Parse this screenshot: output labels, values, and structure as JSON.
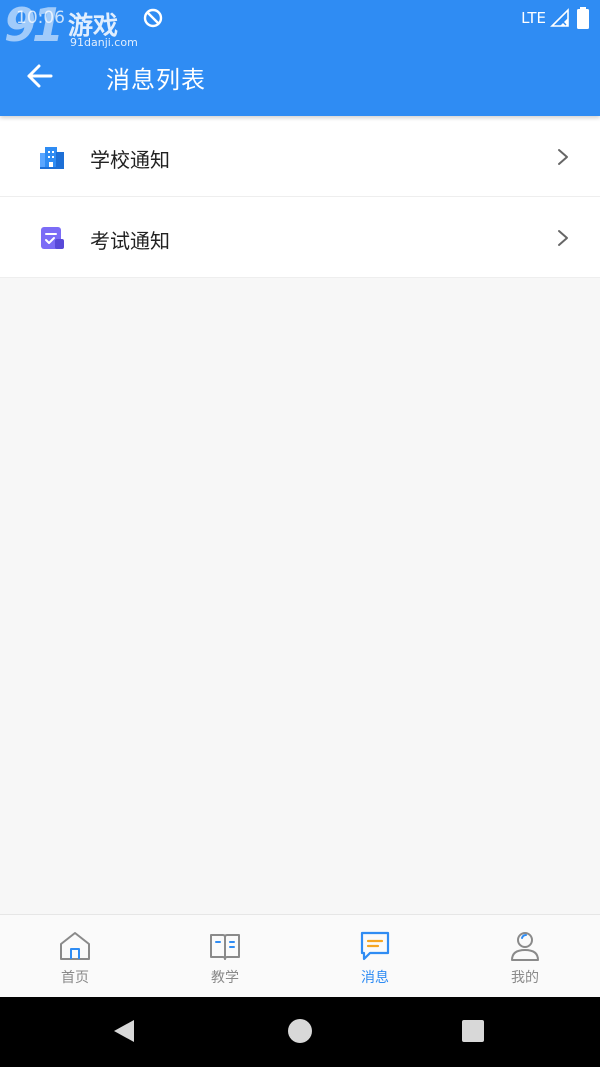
{
  "status_bar": {
    "time": "10:06",
    "network": "LTE",
    "watermark_cn": "游戏",
    "watermark_num": "91",
    "watermark_url": "91danji.com"
  },
  "toolbar": {
    "title": "消息列表"
  },
  "list": {
    "items": [
      {
        "label": "学校通知",
        "icon": "school-building-icon"
      },
      {
        "label": "考试通知",
        "icon": "exam-note-icon"
      }
    ]
  },
  "tabbar": {
    "tabs": [
      {
        "label": "首页",
        "icon": "home-icon",
        "active": false
      },
      {
        "label": "教学",
        "icon": "book-icon",
        "active": false
      },
      {
        "label": "消息",
        "icon": "message-icon",
        "active": true
      },
      {
        "label": "我的",
        "icon": "user-icon",
        "active": false
      }
    ]
  },
  "colors": {
    "primary": "#2f8cf3",
    "accent_orange": "#f5a623",
    "exam_purple": "#7b6cf6",
    "inactive": "#8a8a8a"
  }
}
